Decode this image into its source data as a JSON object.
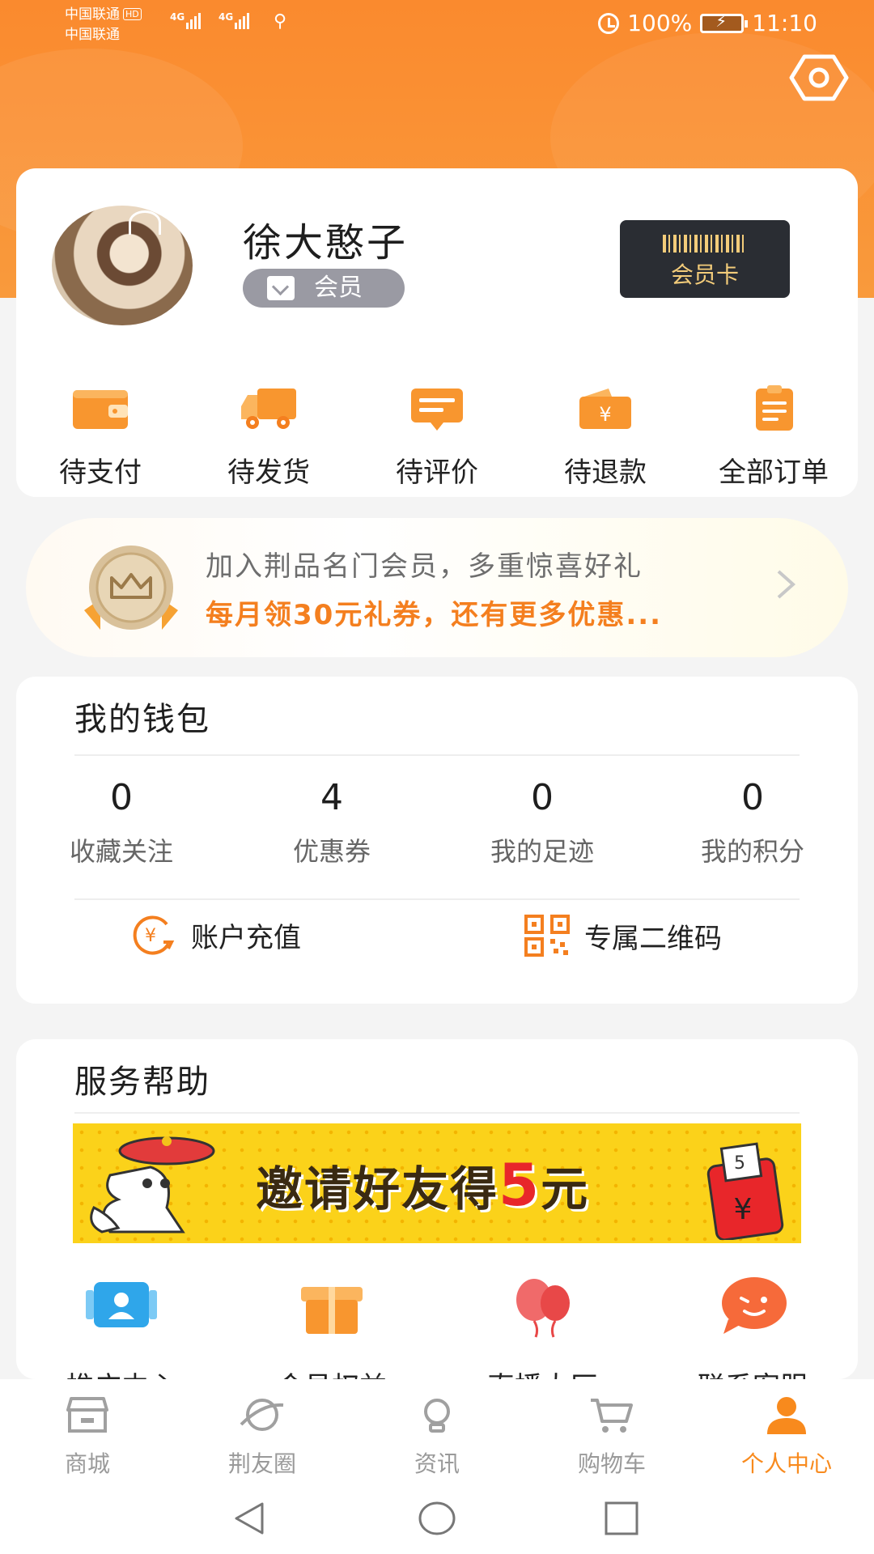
{
  "status_bar": {
    "carrier_line1": "中国联通",
    "carrier_line2": "中国联通",
    "hd": "HD",
    "network1": "4G",
    "network2": "4G",
    "battery": "100%",
    "time": "11:10"
  },
  "profile": {
    "name": "徐大憨子",
    "member_label": "会员",
    "member_card_label": "会员卡"
  },
  "orders": [
    {
      "label": "待支付",
      "icon": "wallet-icon"
    },
    {
      "label": "待发货",
      "icon": "truck-icon"
    },
    {
      "label": "待评价",
      "icon": "comment-icon"
    },
    {
      "label": "待退款",
      "icon": "refund-icon"
    },
    {
      "label": "全部订单",
      "icon": "clipboard-icon"
    }
  ],
  "promo": {
    "line1": "加入荆品名门会员，多重惊喜好礼",
    "line2": "每月领30元礼券，还有更多优惠..."
  },
  "wallet": {
    "title": "我的钱包",
    "stats": [
      {
        "value": "0",
        "label": "收藏关注"
      },
      {
        "value": "4",
        "label": "优惠券"
      },
      {
        "value": "0",
        "label": "我的足迹"
      },
      {
        "value": "0",
        "label": "我的积分"
      }
    ],
    "recharge_label": "账户充值",
    "qrcode_label": "专属二维码"
  },
  "service": {
    "title": "服务帮助",
    "banner_text_a": "邀请好友得",
    "banner_text_num": "5",
    "banner_text_b": "元",
    "items": [
      {
        "label": "推广中心",
        "icon": "promotion-center-icon"
      },
      {
        "label": "会员权益",
        "icon": "gift-box-icon"
      },
      {
        "label": "直播大厅",
        "icon": "balloons-icon"
      },
      {
        "label": "联系客服",
        "icon": "chat-bubble-icon"
      }
    ]
  },
  "bottom_nav": [
    {
      "label": "商城",
      "icon": "store-icon",
      "active": false
    },
    {
      "label": "荆友圈",
      "icon": "planet-icon",
      "active": false
    },
    {
      "label": "资讯",
      "icon": "lightbulb-icon",
      "active": false
    },
    {
      "label": "购物车",
      "icon": "cart-icon",
      "active": false
    },
    {
      "label": "个人中心",
      "icon": "person-icon",
      "active": true
    }
  ],
  "colors": {
    "brand_orange": "#f88a1d",
    "header_gradient_top": "#fa8a2e",
    "promo_text": "#f47f1f"
  }
}
